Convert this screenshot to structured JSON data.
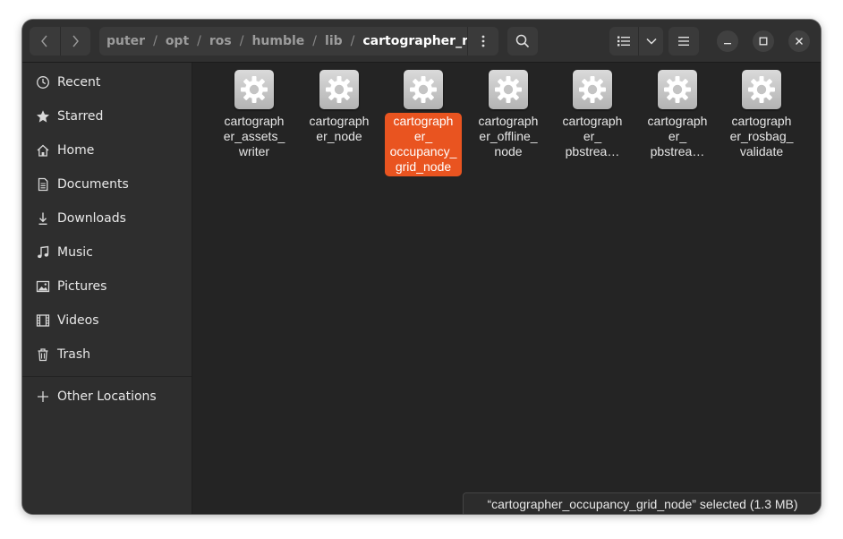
{
  "header": {
    "back_label": "Back",
    "forward_label": "Forward",
    "path": [
      {
        "label": "puter",
        "current": false
      },
      {
        "label": "opt",
        "current": false
      },
      {
        "label": "ros",
        "current": false
      },
      {
        "label": "humble",
        "current": false
      },
      {
        "label": "lib",
        "current": false
      },
      {
        "label": "cartographer_ros",
        "current": true
      }
    ],
    "path_separator": "/",
    "icons": {
      "back": "chevron-left-icon",
      "forward": "chevron-right-icon",
      "path_menu": "vertical-ellipsis-icon",
      "search": "search-icon",
      "view": "list-view-icon",
      "view_options": "chevron-down-icon",
      "main_menu": "hamburger-menu-icon",
      "minimize": "minimize-icon",
      "maximize": "maximize-icon",
      "close": "close-icon"
    }
  },
  "sidebar": {
    "items": [
      {
        "label": "Recent",
        "icon": "clock-icon"
      },
      {
        "label": "Starred",
        "icon": "star-icon"
      },
      {
        "label": "Home",
        "icon": "home-icon"
      },
      {
        "label": "Documents",
        "icon": "document-icon"
      },
      {
        "label": "Downloads",
        "icon": "download-icon"
      },
      {
        "label": "Music",
        "icon": "music-note-icon"
      },
      {
        "label": "Pictures",
        "icon": "picture-icon"
      },
      {
        "label": "Videos",
        "icon": "film-icon"
      },
      {
        "label": "Trash",
        "icon": "trash-icon"
      }
    ],
    "other_locations": {
      "label": "Other Locations",
      "icon": "plus-icon"
    }
  },
  "files": [
    {
      "name": "cartographer_assets_writer",
      "lines": [
        "cartograph",
        "er_assets_",
        "writer"
      ],
      "icon": "executable-gear-icon",
      "selected": false
    },
    {
      "name": "cartographer_node",
      "lines": [
        "cartograph",
        "er_node"
      ],
      "icon": "executable-gear-icon",
      "selected": false
    },
    {
      "name": "cartographer_occupancy_grid_node",
      "lines": [
        "cartograph",
        "er_",
        "occupancy_",
        "grid_node"
      ],
      "icon": "executable-gear-icon",
      "selected": true
    },
    {
      "name": "cartographer_offline_node",
      "lines": [
        "cartograph",
        "er_offline_",
        "node"
      ],
      "icon": "executable-gear-icon",
      "selected": false
    },
    {
      "name": "cartographer_pbstream...",
      "lines": [
        "cartograph",
        "er_",
        "pbstrea…"
      ],
      "icon": "executable-gear-icon",
      "selected": false
    },
    {
      "name": "cartographer_pbstream...",
      "lines": [
        "cartograph",
        "er_",
        "pbstrea…"
      ],
      "icon": "executable-gear-icon",
      "selected": false
    },
    {
      "name": "cartographer_rosbag_validate",
      "lines": [
        "cartograph",
        "er_rosbag_",
        "validate"
      ],
      "icon": "executable-gear-icon",
      "selected": false
    }
  ],
  "status": {
    "text": "“cartographer_occupancy_grid_node” selected  (1.3 MB)"
  },
  "colors": {
    "accent": "#e95420",
    "window_bg": "#242424",
    "sidebar_bg": "#2e2e2e",
    "header_bg": "#303030"
  }
}
